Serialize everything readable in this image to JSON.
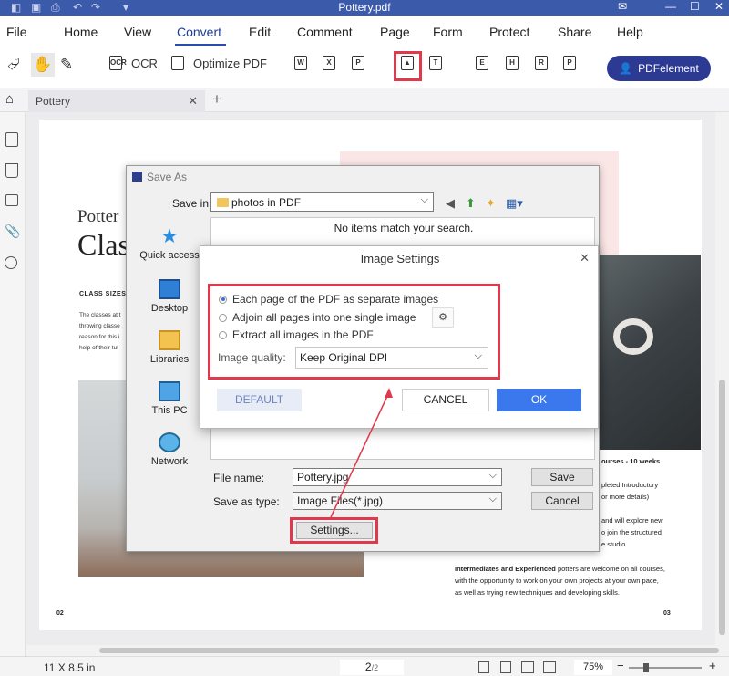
{
  "window": {
    "title": "Pottery.pdf"
  },
  "menu": {
    "items": [
      "File",
      "Home",
      "View",
      "Convert",
      "Edit",
      "Comment",
      "Page",
      "Form",
      "Protect",
      "Share",
      "Help"
    ],
    "active": "Convert"
  },
  "toolbar": {
    "ocr_label": "OCR",
    "optimize_label": "Optimize PDF",
    "product_button": "PDFelement"
  },
  "tabs": {
    "document": "Pottery"
  },
  "page": {
    "heading_small": "Potter",
    "heading_large": "Clas",
    "section_header": "CLASS SIZES",
    "left_body": [
      "The classes at t",
      "throwing classe",
      "reason for this i",
      "help of their tut"
    ],
    "right_lines": [
      "ourses - 10 weeks",
      "pleted Introductory",
      "or more details)",
      "and will explore new",
      "o join the structured",
      "e studio."
    ],
    "right_paragraph": {
      "bold": "Intermediates and Experienced",
      "rest1": " potters are welcome on all courses,",
      "line2": "with the opportunity to work on your own projects at your own pace,",
      "line3": "as well as trying new techniques and developing skills."
    },
    "page_left": "02",
    "page_right": "03"
  },
  "save_as": {
    "title": "Save As",
    "save_in_label": "Save in:",
    "save_in_value": "photos in PDF",
    "empty_message": "No items match your search.",
    "places": [
      "Quick access",
      "Desktop",
      "Libraries",
      "This PC",
      "Network"
    ],
    "file_name_label": "File name:",
    "file_name_value": "Pottery.jpg",
    "save_type_label": "Save as type:",
    "save_type_value": "Image Files(*.jpg)",
    "save_button": "Save",
    "cancel_button": "Cancel",
    "settings_button": "Settings..."
  },
  "image_settings": {
    "title": "Image Settings",
    "options": [
      "Each page of the PDF as separate images",
      "Adjoin all pages into one single image",
      "Extract all images in the PDF"
    ],
    "selected_option": 0,
    "quality_label": "Image quality:",
    "quality_value": "Keep Original DPI",
    "default_button": "DEFAULT",
    "cancel_button": "CANCEL",
    "ok_button": "OK"
  },
  "status": {
    "page_size": "11 X 8.5 in",
    "current_page": "2",
    "total_pages": "/2",
    "zoom": "75%"
  },
  "colors": {
    "accent": "#2c3a94",
    "highlight": "#e0384c",
    "ok_button": "#3b78ee",
    "titlebar": "#3c5aaa"
  }
}
